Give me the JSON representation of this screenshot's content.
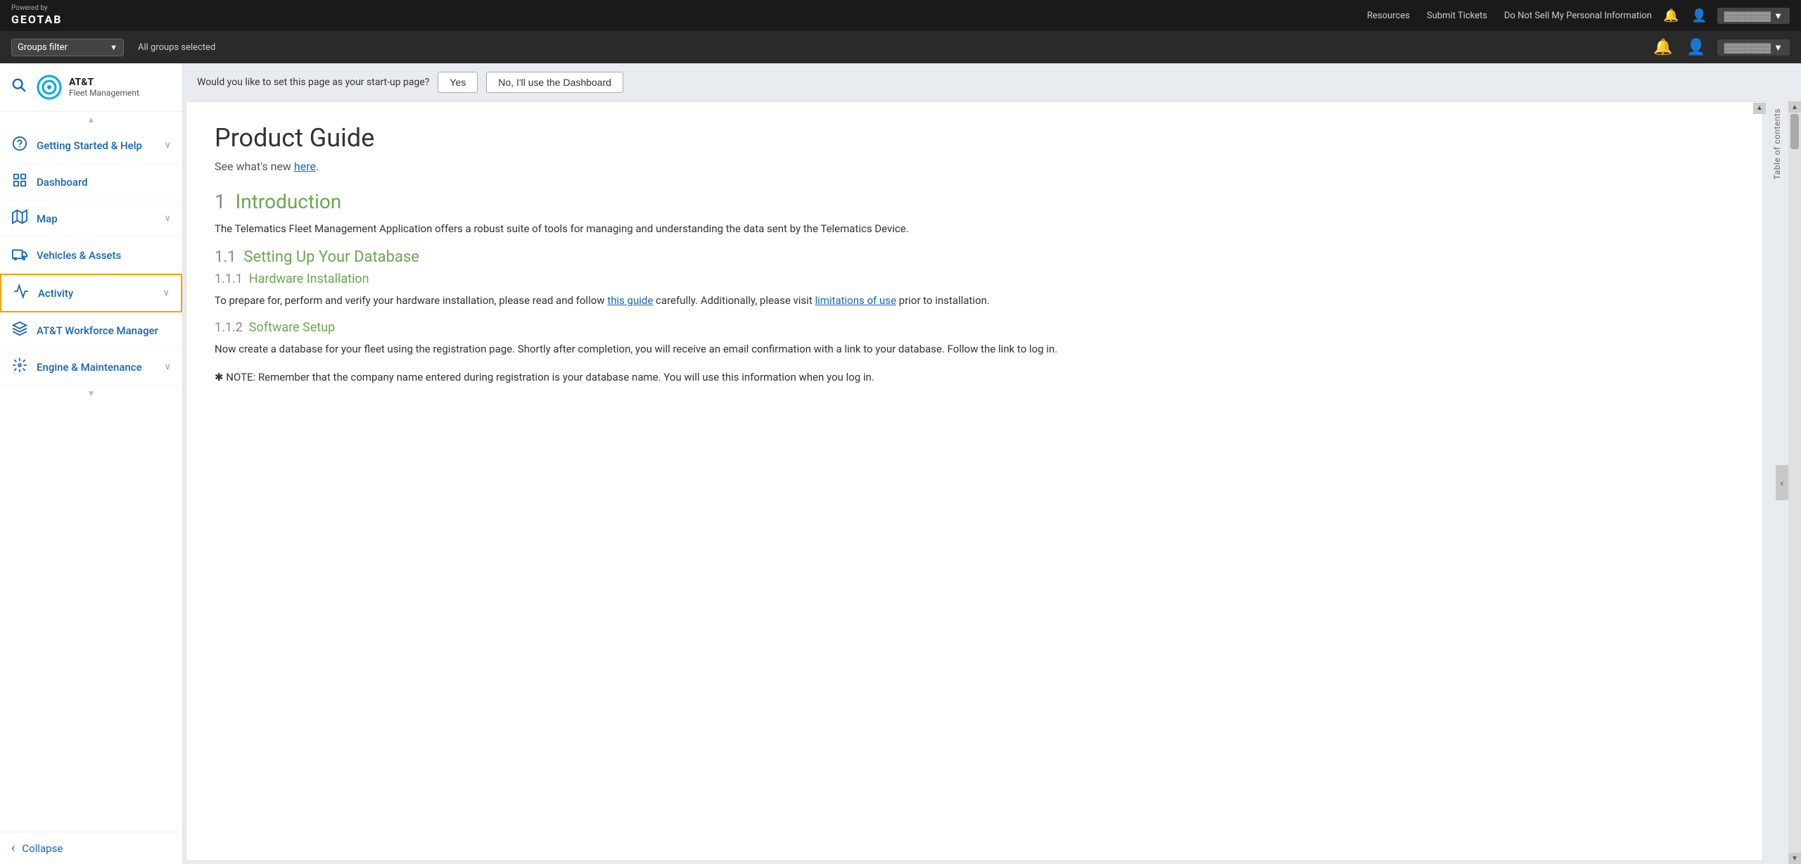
{
  "topbar": {
    "powered_by": "Powered by",
    "brand": "GEOTAB",
    "nav_items": [
      {
        "label": "Resources",
        "id": "resources"
      },
      {
        "label": "Submit Tickets",
        "id": "submit-tickets"
      },
      {
        "label": "Do Not Sell My Personal Information",
        "id": "privacy"
      }
    ],
    "notification_icon": "🔔",
    "user_icon": "👤"
  },
  "filterbar": {
    "groups_filter_label": "Groups filter",
    "chevron": "▼",
    "selected_text": "All groups selected"
  },
  "sidebar": {
    "search_icon": "🔍",
    "org": {
      "name": "AT&T",
      "subtitle": "Fleet Management"
    },
    "scroll_up_icon": "▲",
    "nav_items": [
      {
        "id": "getting-started",
        "label": "Getting Started & Help",
        "icon": "❓",
        "has_chevron": true,
        "active": false
      },
      {
        "id": "dashboard",
        "label": "Dashboard",
        "icon": "📊",
        "has_chevron": false,
        "active": false
      },
      {
        "id": "map",
        "label": "Map",
        "icon": "🗺",
        "has_chevron": true,
        "active": false
      },
      {
        "id": "vehicles",
        "label": "Vehicles & Assets",
        "icon": "🚚",
        "has_chevron": false,
        "active": false
      },
      {
        "id": "activity",
        "label": "Activity",
        "icon": "📈",
        "has_chevron": true,
        "active": true
      },
      {
        "id": "att-workforce",
        "label": "AT&T Workforce Manager",
        "icon": "🧩",
        "has_chevron": false,
        "active": false
      },
      {
        "id": "engine",
        "label": "Engine & Maintenance",
        "icon": "📹",
        "has_chevron": true,
        "active": false
      }
    ],
    "collapse_label": "Collapse",
    "collapse_icon": "‹"
  },
  "startup_banner": {
    "question": "Would you like to set this page as your start-up page?",
    "yes_label": "Yes",
    "no_label": "No, I'll use the Dashboard"
  },
  "toc": {
    "label": "Table of contents",
    "collapse_icon": "‹"
  },
  "doc": {
    "title": "Product Guide",
    "subtitle_text": "See what's new ",
    "subtitle_link_text": "here",
    "subtitle_suffix": ".",
    "sections": [
      {
        "id": "intro",
        "num": "1",
        "title": "Introduction",
        "body": "The Telematics Fleet Management Application offers a robust suite of tools for managing and understanding the data sent by the Telematics Device."
      },
      {
        "id": "setup",
        "num": "1.1",
        "title": "Setting Up Your Database"
      },
      {
        "id": "hardware",
        "num": "1.1.1",
        "title": "Hardware Installation",
        "body_pre": "To prepare for, perform and verify your hardware installation, please read and follow ",
        "body_link": "this guide",
        "body_mid": " carefully. Additionally, please visit ",
        "body_link2": "limitations of use",
        "body_post": " prior to installation."
      },
      {
        "id": "software",
        "num": "1.1.2",
        "title": "Software Setup",
        "body": "Now create a database for your fleet using the registration page. Shortly after completion, you will receive an email confirmation with a link to your database. Follow the link to log in."
      }
    ],
    "note": "✱ NOTE: Remember that the company name entered during registration is your database name. You will use this information when you log in."
  }
}
